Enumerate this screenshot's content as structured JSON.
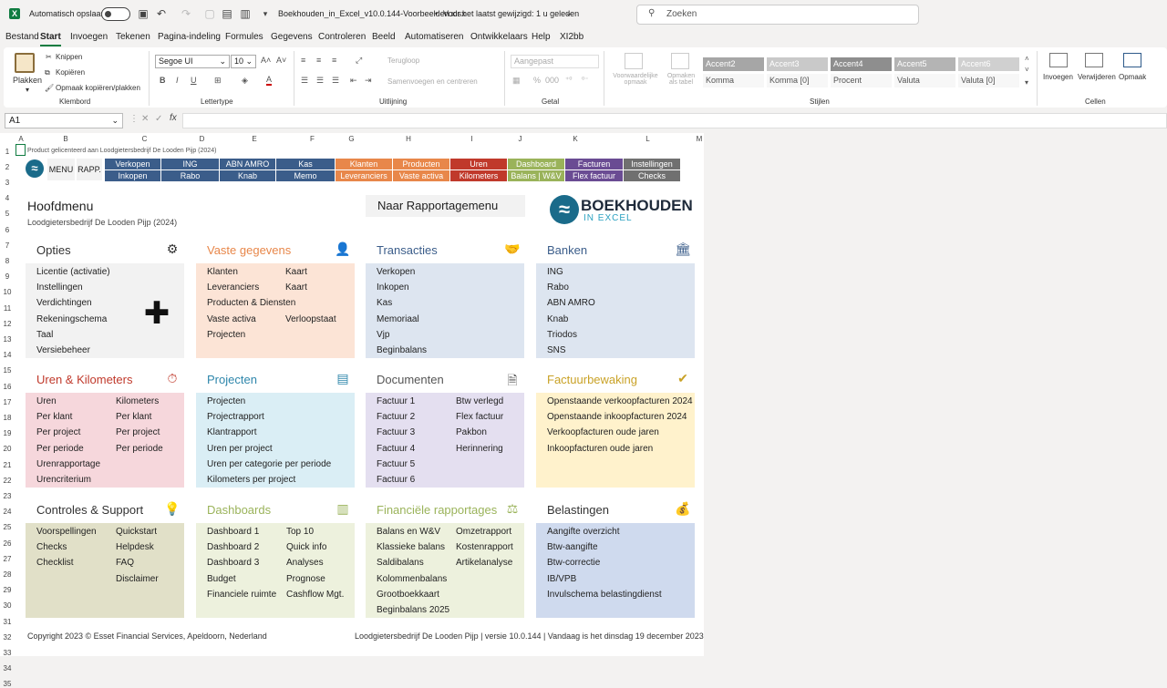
{
  "titlebar": {
    "app_icon": "X",
    "autosave_label": "Automatisch opslaan",
    "filename": "Boekhouden_in_Excel_v10.0.144-Voorbeelden.xlsx",
    "separator": "•",
    "saved_status": "Voor het laatst gewijzigd: 1 u geleden",
    "search_placeholder": "Zoeken"
  },
  "menu": [
    "Bestand",
    "Start",
    "Invoegen",
    "Tekenen",
    "Pagina-indeling",
    "Formules",
    "Gegevens",
    "Controleren",
    "Beeld",
    "Automatiseren",
    "Ontwikkelaars",
    "Help",
    "XI2bb"
  ],
  "ribbon": {
    "paste": "Plakken",
    "cut": "Knippen",
    "copy": "Kopiëren",
    "format_painter": "Opmaak kopiëren/plakken",
    "clipboard": "Klembord",
    "font_name": "Segoe UI",
    "font_size": "10",
    "font_group": "Lettertype",
    "wrap": "Terugloop",
    "merge": "Samenvoegen en centreren",
    "align_group": "Uitlijning",
    "number_format": "Aangepast",
    "number_group": "Getal",
    "cond_format": "Voorwaardelijke opmaak",
    "format_table": "Opmaken als tabel",
    "styles_group": "Stijlen",
    "styles_row1": [
      "Accent2",
      "Accent3",
      "Accent4",
      "Accent5",
      "Accent6"
    ],
    "styles_row2": [
      "Komma",
      "Komma [0]",
      "Procent",
      "Valuta",
      "Valuta [0]"
    ],
    "insert": "Invoegen",
    "delete": "Verwijderen",
    "format": "Opmaak",
    "cells_group": "Cellen"
  },
  "formula": {
    "name_box": "A1",
    "fx": "fx"
  },
  "columns": [
    "A",
    "B",
    "C",
    "D",
    "E",
    "F",
    "G",
    "H",
    "I",
    "J",
    "K",
    "L",
    "M"
  ],
  "rows": [
    "1",
    "2",
    "3",
    "4",
    "5",
    "6",
    "7",
    "8",
    "9",
    "10",
    "11",
    "12",
    "13",
    "14",
    "15",
    "16",
    "17",
    "18",
    "19",
    "20",
    "21",
    "22",
    "23",
    "24",
    "25",
    "26",
    "27",
    "28",
    "29",
    "30",
    "31",
    "32",
    "33",
    "34",
    "35"
  ],
  "sheet": {
    "product_line": "Product gelicenteerd aan Loodgietersbedrijf De Looden Pijp (2024)",
    "menu_btn": "MENU",
    "rapp_btn": "RAPP.",
    "nav_row1": [
      "Verkopen",
      "ING",
      "ABN AMRO",
      "Kas",
      "Klanten",
      "Producten",
      "Uren",
      "Dashboard",
      "Facturen",
      "Instellingen"
    ],
    "nav_row2": [
      "Inkopen",
      "Rabo",
      "Knab",
      "Memo",
      "Leveranciers",
      "Vaste activa",
      "Kilometers",
      "Balans | W&V",
      "Flex factuur",
      "Checks"
    ],
    "title": "Hoofdmenu",
    "company": "Loodgietersbedrijf De Looden Pijp (2024)",
    "report_btn": "Naar Rapportagemenu",
    "logo_main": "BOEKHOUDEN",
    "logo_sub": "IN EXCEL",
    "footer_left": "Copyright 2023 © Esset Financial Services, Apeldoorn, Nederland",
    "footer_right": "Loodgietersbedrijf De Looden Pijp | versie 10.0.144 | Vandaag is het dinsdag 19 december 2023"
  },
  "sections": [
    {
      "title": "Opties",
      "color": "#333333",
      "bg": "#f2f2f2",
      "icon": "gear-icon",
      "items": [
        "Licentie (activatie)",
        "Instellingen",
        "Verdichtingen",
        "Rekeningschema",
        "Taal",
        "Versiebeheer"
      ],
      "items2": []
    },
    {
      "title": "Vaste gegevens",
      "color": "#e8874a",
      "bg": "#fce4d6",
      "icon": "person-icon",
      "items": [
        "Klanten",
        "Leveranciers",
        "Producten & Diensten",
        "Vaste activa",
        "Projecten"
      ],
      "items2": [
        "Kaart",
        "Kaart",
        "",
        "Verloopstaat"
      ]
    },
    {
      "title": "Transacties",
      "color": "#3b5d8a",
      "bg": "#dde5f0",
      "icon": "hand-coin-icon",
      "items": [
        "Verkopen",
        "Inkopen",
        "Kas",
        "Memoriaal",
        "Vjp",
        "Beginbalans"
      ],
      "items2": []
    },
    {
      "title": "Banken",
      "color": "#3b5d8a",
      "bg": "#dde5f0",
      "icon": "bank-icon",
      "items": [
        "ING",
        "Rabo",
        "ABN AMRO",
        "Knab",
        "Triodos",
        "SNS"
      ],
      "items2": []
    },
    {
      "title": "Uren & Kilometers",
      "color": "#c0392b",
      "bg": "#f6d7dc",
      "icon": "stopwatch-icon",
      "items": [
        "Uren",
        "Per klant",
        "Per project",
        "Per periode",
        "Urenrapportage",
        "Urencriterium"
      ],
      "items2": [
        "Kilometers",
        "Per klant",
        "Per project",
        "Per periode"
      ]
    },
    {
      "title": "Projecten",
      "color": "#2e86ab",
      "bg": "#daeef5",
      "icon": "list-icon",
      "items": [
        "Projecten",
        "Projectrapport",
        "Klantrapport",
        "Uren per project",
        "Uren per categorie per periode",
        "Kilometers per project"
      ],
      "items2": []
    },
    {
      "title": "Documenten",
      "color": "#555555",
      "bg": "#e4dff0",
      "icon": "document-icon",
      "items": [
        "Factuur 1",
        "Factuur 2",
        "Factuur 3",
        "Factuur 4",
        "Factuur 5",
        "Factuur 6"
      ],
      "items2": [
        "Btw verlegd",
        "Flex factuur",
        "Pakbon",
        "Herinnering"
      ]
    },
    {
      "title": "Factuurbewaking",
      "color": "#c9a227",
      "bg": "#fff2cc",
      "icon": "check-circle-icon",
      "items": [
        "Openstaande verkoopfacturen 2024",
        "Openstaande inkoopfacturen 2024",
        "Verkoopfacturen oude jaren",
        "Inkoopfacturen oude jaren"
      ],
      "items2": []
    },
    {
      "title": "Controles & Support",
      "color": "#333333",
      "bg": "#e1e0c8",
      "icon": "lightbulb-icon",
      "items": [
        "Voorspellingen",
        "Checks",
        "Checklist"
      ],
      "items2": [
        "Quickstart",
        "Helpdesk",
        "FAQ",
        "Disclaimer"
      ]
    },
    {
      "title": "Dashboards",
      "color": "#9ab35a",
      "bg": "#edf1dd",
      "icon": "bar-chart-icon",
      "items": [
        "Dashboard 1",
        "Dashboard 2",
        "Dashboard 3",
        "Budget",
        "Financiele ruimte"
      ],
      "items2": [
        "Top 10",
        "Quick info",
        "Analyses",
        "Prognose",
        "Cashflow Mgt."
      ]
    },
    {
      "title": "Financiële rapportages",
      "color": "#9ab35a",
      "bg": "#edf1dd",
      "icon": "scale-icon",
      "items": [
        "Balans en W&V",
        "Klassieke balans",
        "Saldibalans",
        "Kolommenbalans",
        "Grootboekkaart",
        "Beginbalans 2025"
      ],
      "items2": [
        "Omzetrapport",
        "Kostenrapport",
        "Artikelanalyse"
      ]
    },
    {
      "title": "Belastingen",
      "color": "#333333",
      "bg": "#cfdaee",
      "icon": "money-bag-icon",
      "items": [
        "Aangifte overzicht",
        "Btw-aangifte",
        "Btw-correctie",
        "IB/VPB",
        "Invulschema belastingdienst"
      ],
      "items2": []
    }
  ]
}
